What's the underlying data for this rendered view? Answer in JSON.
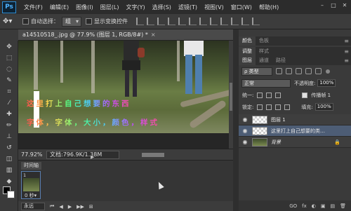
{
  "app": {
    "logo": "Ps",
    "menu": [
      "文件(F)",
      "编辑(E)",
      "图像(I)",
      "图层(L)",
      "文字(Y)",
      "选择(S)",
      "滤镜(T)",
      "视图(V)",
      "窗口(W)",
      "帮助(H)"
    ],
    "window_controls": [
      "–",
      "□",
      "✕"
    ]
  },
  "options_bar": {
    "tool_icon": "move-tool-icon",
    "auto_select_label": "自动选择：",
    "auto_select_value": "组",
    "show_transform_label": "显示变换控件"
  },
  "document": {
    "tab_title": "a14510518_.jpg @ 77.9% (图层 1, RGB/8#) *",
    "close": "×",
    "canvas_text_line1": "这里打上自己想要的东西",
    "canvas_text_line2": "字体，字体，大小，颜色，样式"
  },
  "status_bar": {
    "zoom": "77.92%",
    "doc_info": "文档:796.9K/1.38M",
    "arrow": "▶"
  },
  "timeline": {
    "tab_label": "时间轴",
    "frame_number": "1",
    "frame_delay": "0 秒▾",
    "loop": "永远",
    "controls": [
      "⏮",
      "◀",
      "▶",
      "▶▶",
      "⊞"
    ]
  },
  "panels": {
    "top_tabs": [
      "颜色",
      "色板"
    ],
    "mid_tabs": [
      "调整",
      "样式"
    ],
    "layer_tabs": [
      "图层",
      "通道",
      "路径"
    ],
    "kind_filter": "ρ 类型",
    "blend_mode": "正常",
    "opacity_label": "不透明度:",
    "opacity_value": "100%",
    "lock_label": "锁定:",
    "fill_label": "填充:",
    "fill_value": "100%",
    "unify_label": "统一:",
    "propagate_label": "传播帧 1",
    "layers": [
      {
        "name": "图层 1",
        "thumb": "transparent",
        "selected": false,
        "italic": false,
        "lock": ""
      },
      {
        "name": "这里打上自己想要的类…",
        "thumb": "transparent",
        "selected": true,
        "italic": false,
        "lock": ""
      },
      {
        "name": "背景",
        "thumb": "photo",
        "selected": false,
        "italic": true,
        "lock": "🔒"
      }
    ],
    "bottom_icons": [
      "GO",
      "fx",
      "◐",
      "▣",
      "▤",
      "🗑"
    ]
  }
}
